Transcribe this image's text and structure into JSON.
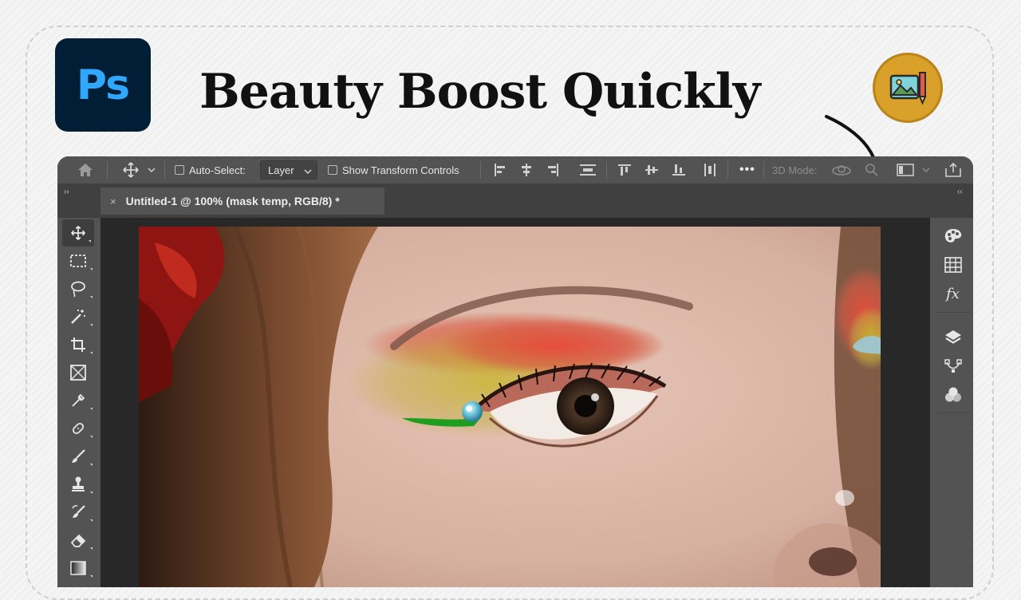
{
  "thumbnail": {
    "logo_text": "Ps",
    "headline": "Beauty Boost Quickly",
    "badge_icon": "image-edit-icon",
    "colors": {
      "logo_bg": "#001e36",
      "logo_fg": "#31a8ff",
      "badge": "#d9a129"
    }
  },
  "options_bar": {
    "auto_select_label": "Auto-Select:",
    "auto_select_value": "Layer",
    "show_transform_label": "Show Transform Controls",
    "mode_label": "3D Mode:",
    "more_label": "•••"
  },
  "tabs": [
    {
      "close": "×",
      "label": "Untitled-1 @ 100% (mask temp, RGB/8) *"
    }
  ],
  "panel_toggles": {
    "left": "››",
    "right": "‹‹"
  },
  "tools": [
    "move-tool",
    "marquee-tool",
    "lasso-tool",
    "magic-wand-tool",
    "crop-tool",
    "frame-tool",
    "eyedropper-tool",
    "healing-brush-tool",
    "brush-tool",
    "clone-stamp-tool",
    "history-brush-tool",
    "eraser-tool",
    "gradient-tool"
  ],
  "right_panels": [
    "color-icon",
    "swatches-icon",
    "fx-icon",
    "layers-icon",
    "paths-icon",
    "channels-icon"
  ],
  "right_panel_fx_label": "fx"
}
